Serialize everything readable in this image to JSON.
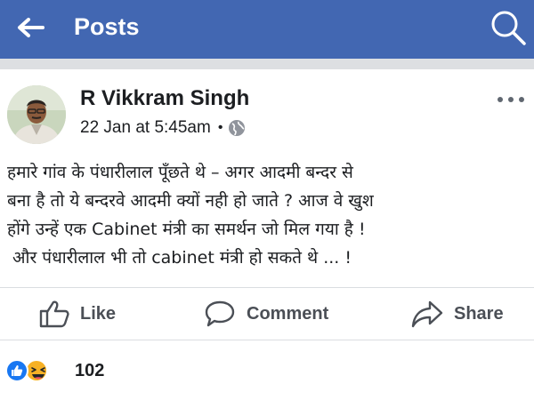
{
  "header": {
    "title": "Posts",
    "back_icon": "arrow-left-icon",
    "search_icon": "search-icon",
    "background": "#4267b2"
  },
  "post": {
    "author": "R Vikkram Singh",
    "timestamp": "22 Jan at 5:45am",
    "separator": "•",
    "privacy_icon": "globe-icon",
    "more_icon": "more-dots-icon",
    "lines": [
      "हमारे गांव के पंधारीलाल पूँछते थे – अगर आदमी बन्दर से",
      "बना है तो ये बन्दरवे आदमी क्यों नही हो जाते ? आज वे खुश",
      "होंगे उन्हें एक Cabinet मंत्री का समर्थन जो मिल गया है !",
      " और पंधारीलाल भी तो cabinet मंत्री हो सकते थे ... !"
    ]
  },
  "actions": {
    "like_label": "Like",
    "comment_label": "Comment",
    "share_label": "Share"
  },
  "reactions": {
    "count": "102",
    "icons": [
      "like-reaction-icon",
      "haha-reaction-icon"
    ],
    "like_color": "#1877f2",
    "haha_color": "#f7b125"
  }
}
